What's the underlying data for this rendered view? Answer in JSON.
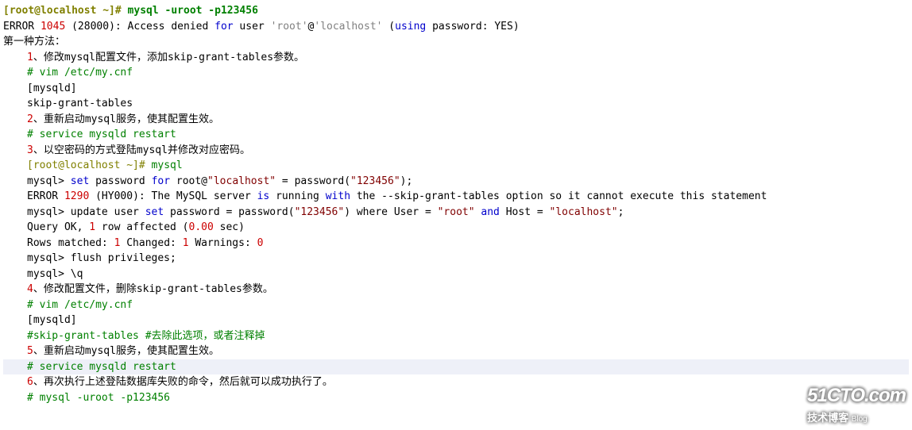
{
  "l1": {
    "p1": "[root@localhost ~]",
    "p2": "# ",
    "cmd": "mysql -uroot -p123456"
  },
  "l2": {
    "a": "ERROR ",
    "b": "1045",
    "c": " (28000): Access denied ",
    "d": "for",
    "e": " user ",
    "f": "'root'",
    "g": "@",
    "h": "'localhost'",
    "i": " (",
    "j": "using",
    "k": " password: YES)"
  },
  "l3": "第一种方法：",
  "l4": {
    "n": "1",
    "t": "、修改mysql配置文件，添加skip-grant-tables参数。"
  },
  "l5": "# vim /etc/my.cnf",
  "l6": "[mysqld]",
  "l7": "skip-grant-tables",
  "l8": {
    "n": "2",
    "t": "、重新启动mysql服务，使其配置生效。"
  },
  "l9": "# service mysqld restart",
  "l10": {
    "n": "3",
    "t": "、以空密码的方式登陆mysql并修改对应密码。"
  },
  "l11": {
    "a": "[root@localhost ~]",
    "b": "# ",
    "c": "mysql"
  },
  "l12": {
    "a": "mysql> ",
    "b": "set",
    "c": " password ",
    "d": "for",
    "e": " root@",
    "f": "\"localhost\"",
    "g": " = password(",
    "h": "\"123456\"",
    "i": ");"
  },
  "l13": {
    "a": "ERROR ",
    "b": "1290",
    "c": " (HY000): The MySQL server ",
    "d": "is",
    "e": " running ",
    "f": "with",
    "g": " the --skip-grant-tables option so it cannot execute this statement"
  },
  "l14": {
    "a": "mysql> update user ",
    "b": "set",
    "c": " password = password(",
    "d": "\"123456\"",
    "e": ") where User = ",
    "f": "\"root\"",
    "g": " ",
    "h": "and",
    "i": " Host = ",
    "j": "\"localhost\"",
    "k": ";"
  },
  "l15": {
    "a": "Query OK, ",
    "b": "1",
    "c": " row affected (",
    "d": "0.00",
    "e": " sec)"
  },
  "l16": {
    "a": "Rows matched: ",
    "b": "1",
    "c": "  Changed: ",
    "d": "1",
    "e": "  Warnings: ",
    "f": "0"
  },
  "l17": "mysql> flush privileges;",
  "l18": "mysql> \\q",
  "l19": {
    "n": "4",
    "t": "、修改配置文件，删除skip-grant-tables参数。"
  },
  "l20": "# vim /etc/my.cnf",
  "l21": "[mysqld]",
  "l22": "#skip-grant-tables #去除此选项，或者注释掉",
  "l23": {
    "n": "5",
    "t": "、重新启动mysql服务，使其配置生效。"
  },
  "l24": "# service mysqld restart",
  "l25": {
    "n": "6",
    "t": "、再次执行上述登陆数据库失败的命令，然后就可以成功执行了。"
  },
  "l26": "# mysql -uroot -p123456",
  "wm": {
    "big": "51CTO.com",
    "small": "技术博客",
    "tag": "Blog"
  }
}
